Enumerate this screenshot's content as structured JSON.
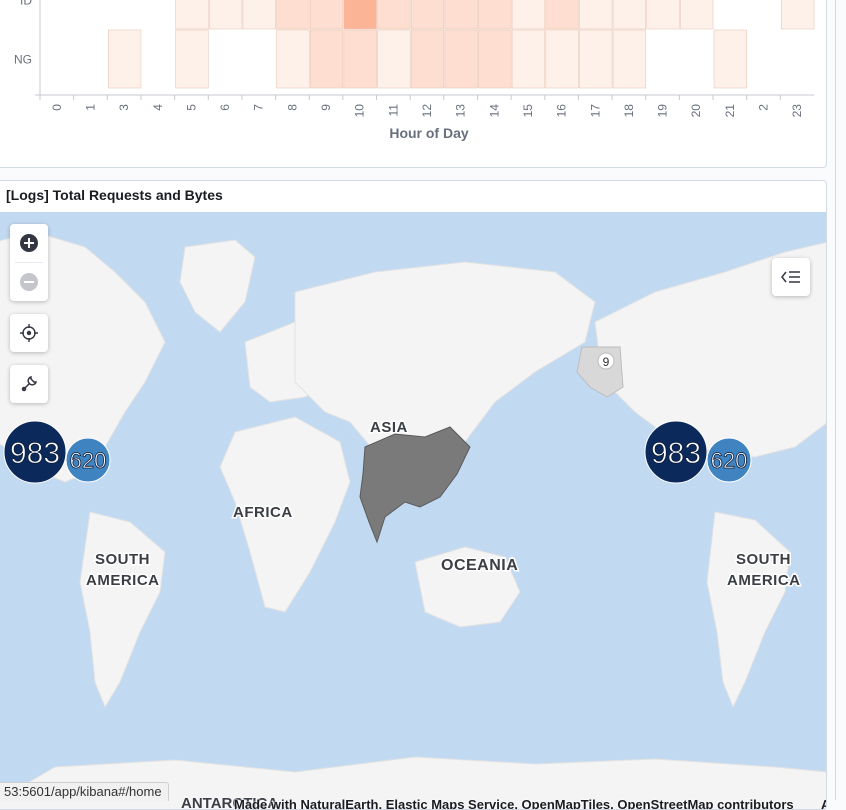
{
  "heatmap": {
    "x_axis_title": "Hour of Day",
    "rows": [
      "ID",
      "NG"
    ],
    "x_ticks": [
      "0",
      "1",
      "3",
      "4",
      "5",
      "6",
      "7",
      "8",
      "9",
      "10",
      "11",
      "12",
      "13",
      "14",
      "15",
      "16",
      "17",
      "18",
      "19",
      "20",
      "21",
      "2",
      "23"
    ],
    "cell_color_base": "#f2704a"
  },
  "chart_data": {
    "type": "heatmap",
    "xlabel": "Hour of Day",
    "ylabel": "",
    "x": [
      "0",
      "1",
      "3",
      "4",
      "5",
      "6",
      "7",
      "8",
      "9",
      "10",
      "11",
      "12",
      "13",
      "14",
      "15",
      "16",
      "17",
      "18",
      "19",
      "20",
      "21",
      "2",
      "23"
    ],
    "y": [
      "ID",
      "NG"
    ],
    "values": [
      [
        0,
        0,
        0,
        0,
        1,
        1,
        1,
        2,
        2,
        4,
        2,
        2,
        2,
        2,
        1,
        2,
        1,
        1,
        1,
        1,
        0,
        0,
        1
      ],
      [
        0,
        0,
        1,
        0,
        1,
        0,
        0,
        1,
        2,
        2,
        1,
        2,
        2,
        2,
        1,
        1,
        1,
        1,
        0,
        0,
        1,
        0,
        0
      ]
    ]
  },
  "map_panel": {
    "title": "[Logs] Total Requests and Bytes",
    "clusters": [
      {
        "label": "983",
        "color": "#0b2a5b"
      },
      {
        "label": "620",
        "color": "#3f84c1"
      },
      {
        "label": "983",
        "color": "#0b2a5b"
      },
      {
        "label": "620",
        "color": "#3f84c1"
      }
    ],
    "small_marker": "9",
    "continent_labels": {
      "asia": "ASIA",
      "africa": "AFRICA",
      "oceania": "OCEANIA",
      "south_america": "SOUTH\nAMERICA",
      "south_america_line1": "SOUTH",
      "south_america_line2": "AMERICA",
      "antarctica": "ANTARCTICA"
    },
    "attribution": "Made with NaturalEarth, Elastic Maps Service, OpenMapTiles, OpenStreetMap contributors",
    "attribution_edge": "A",
    "controls": [
      "zoom-in",
      "zoom-out",
      "set-view",
      "tools"
    ],
    "colors": {
      "ocean": "#c2d9f2",
      "land": "#f4f4f4",
      "highlight_country": "#7a7a7a",
      "alaska": "#d8d8d8"
    }
  },
  "status_bar": {
    "url": "53:5601/app/kibana#/home"
  }
}
